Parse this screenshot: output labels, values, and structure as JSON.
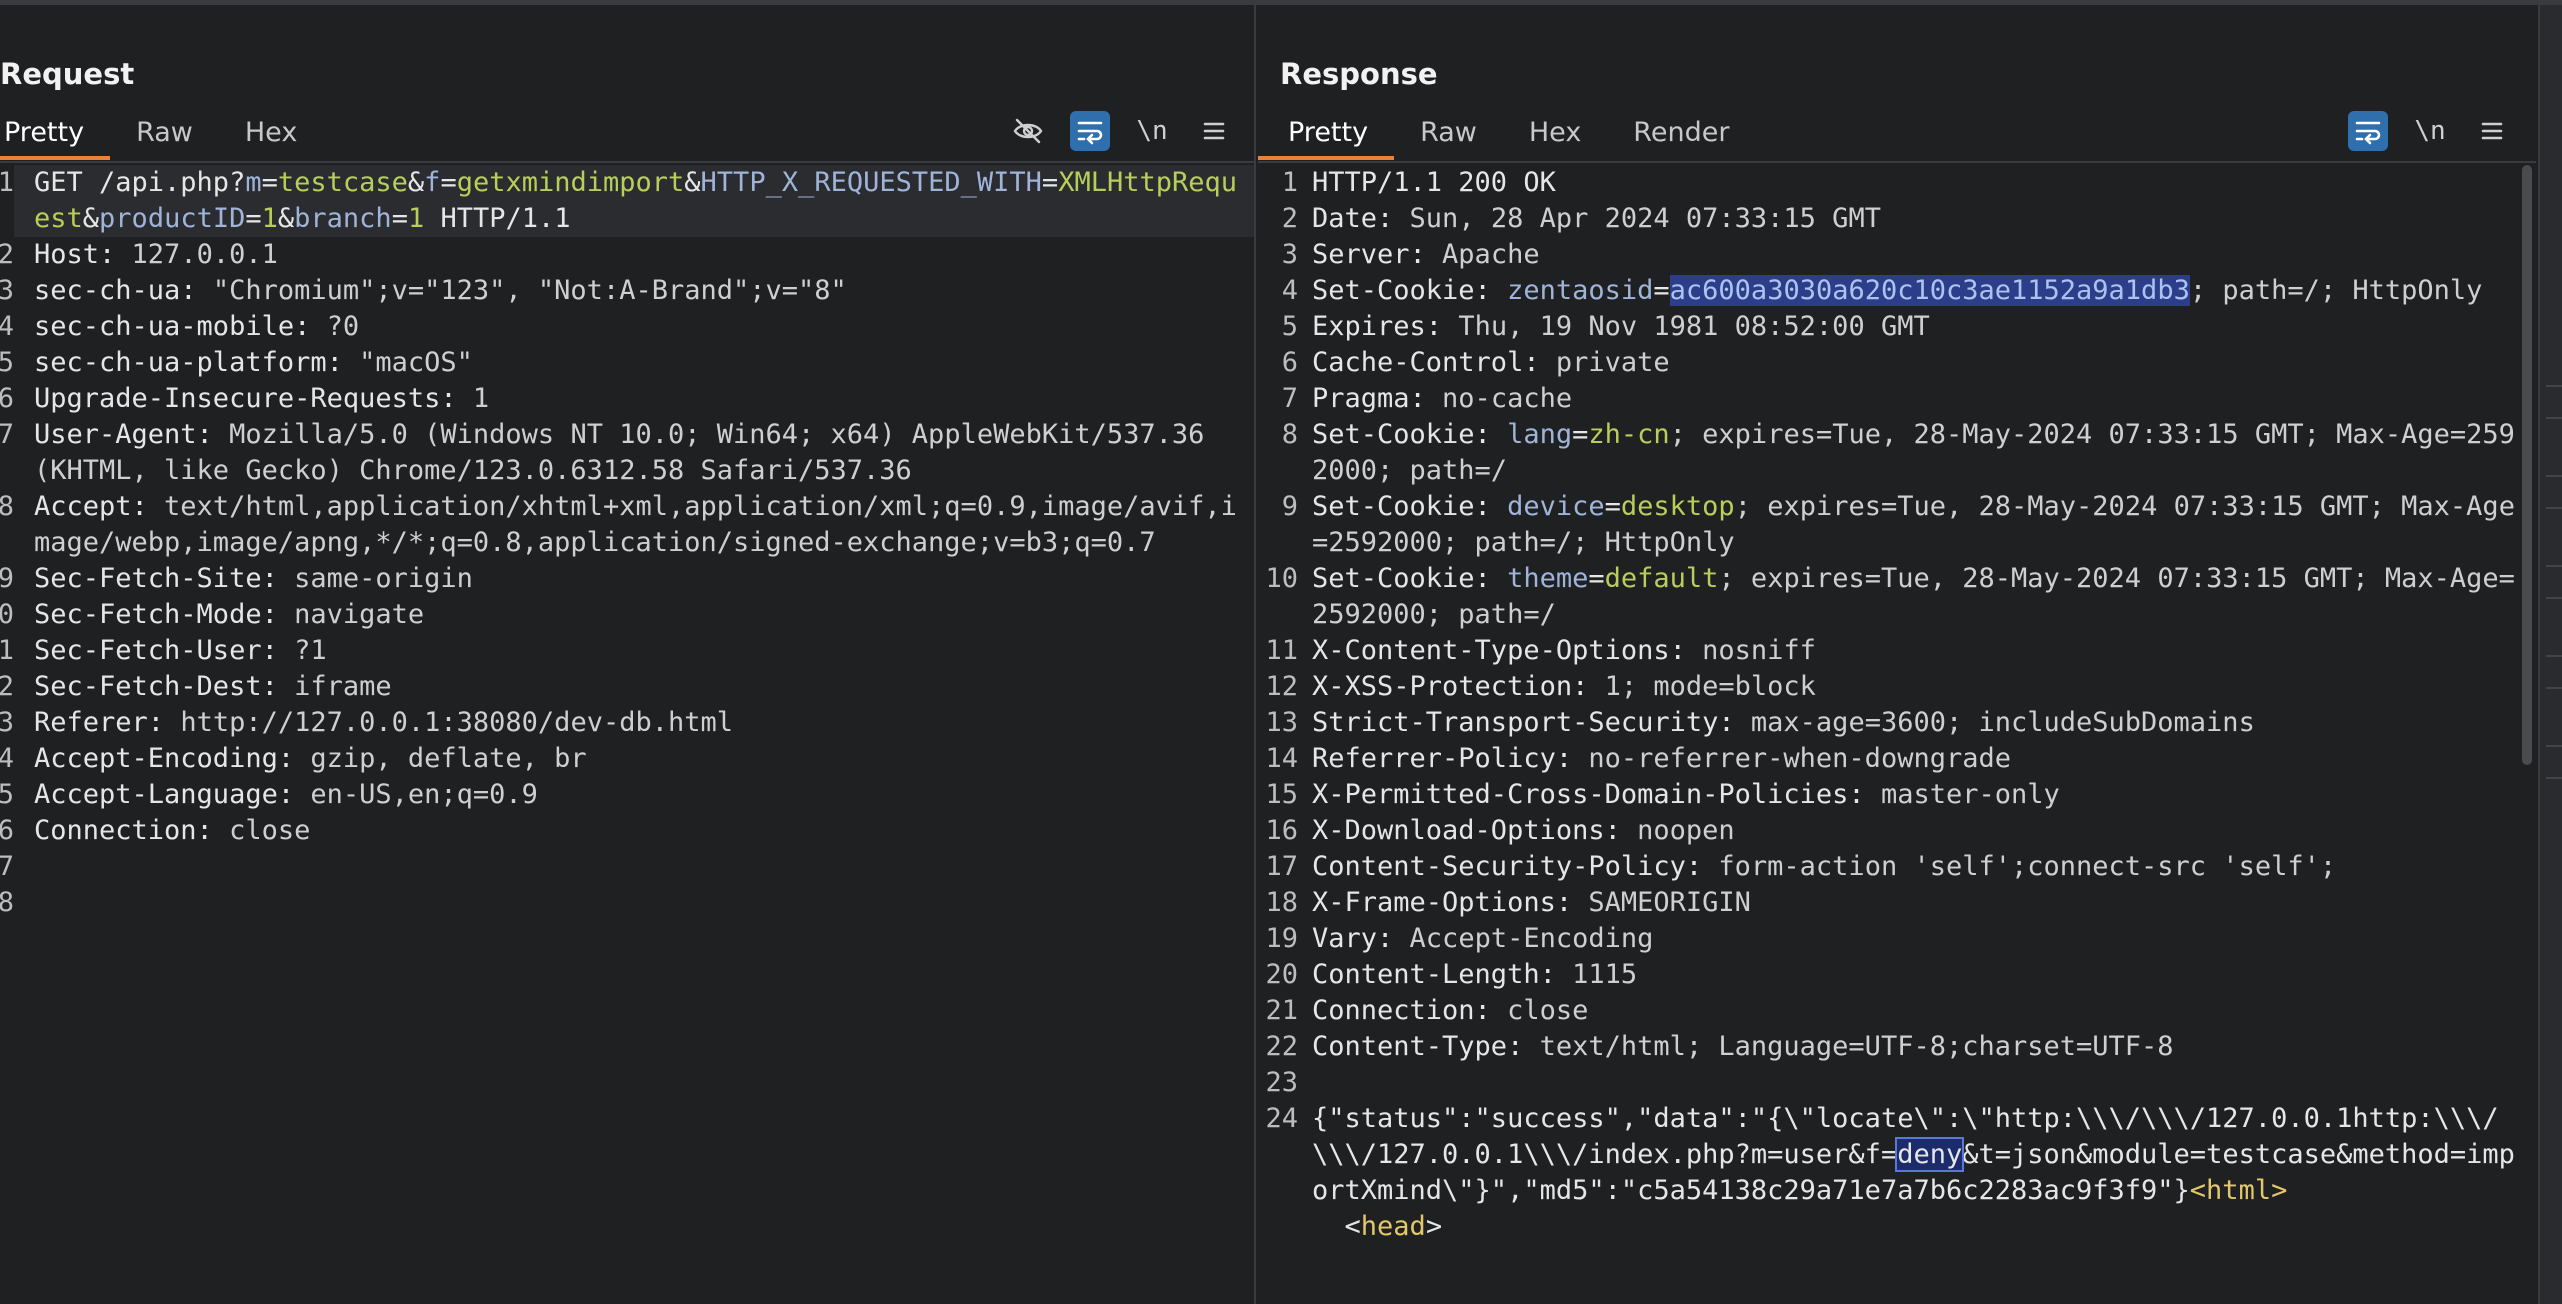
{
  "request": {
    "title": "Request",
    "tabs": [
      "Pretty",
      "Raw",
      "Hex"
    ],
    "tools": {
      "hide_icon": "eye-slash-icon",
      "wrap_icon": "wrap-lines-icon",
      "newline_label": "\\n",
      "menu_icon": "hamburger-menu-icon"
    },
    "lines": [
      {
        "num": "1",
        "parts": [
          [
            "GET /api.php?",
            "plain"
          ],
          [
            "m",
            "param"
          ],
          [
            "=",
            "plain"
          ],
          [
            "testcase",
            "pval"
          ],
          [
            "&",
            "plain"
          ],
          [
            "f",
            "param"
          ],
          [
            "=",
            "plain"
          ],
          [
            "getxmindimport",
            "pval"
          ],
          [
            "&",
            "plain"
          ],
          [
            "HTTP_X_REQUESTED_WITH",
            "param"
          ],
          [
            "=",
            "plain"
          ],
          [
            "XMLHttpRequest",
            "pval"
          ],
          [
            "&",
            "plain"
          ],
          [
            "productID",
            "param"
          ],
          [
            "=",
            "plain"
          ],
          [
            "1",
            "pval"
          ],
          [
            "&",
            "plain"
          ],
          [
            "branch",
            "param"
          ],
          [
            "=",
            "plain"
          ],
          [
            "1",
            "pval"
          ],
          [
            " HTTP/1.1",
            "plain"
          ]
        ]
      },
      {
        "num": "2",
        "parts": [
          [
            "Host: ",
            "hdr"
          ],
          [
            "127.0.0.1",
            "val"
          ]
        ]
      },
      {
        "num": "3",
        "parts": [
          [
            "sec-ch-ua: ",
            "hdr"
          ],
          [
            "\"Chromium\";v=\"123\", \"Not:A-Brand\";v=\"8\"",
            "val"
          ]
        ]
      },
      {
        "num": "4",
        "parts": [
          [
            "sec-ch-ua-mobile: ",
            "hdr"
          ],
          [
            "?0",
            "val"
          ]
        ]
      },
      {
        "num": "5",
        "parts": [
          [
            "sec-ch-ua-platform: ",
            "hdr"
          ],
          [
            "\"macOS\"",
            "val"
          ]
        ]
      },
      {
        "num": "6",
        "parts": [
          [
            "Upgrade-Insecure-Requests: ",
            "hdr"
          ],
          [
            "1",
            "val"
          ]
        ]
      },
      {
        "num": "7",
        "parts": [
          [
            "User-Agent: ",
            "hdr"
          ],
          [
            "Mozilla/5.0 (Windows NT 10.0; Win64; x64) AppleWebKit/537.36 (KHTML, like Gecko) Chrome/123.0.6312.58 Safari/537.36",
            "val"
          ]
        ]
      },
      {
        "num": "8",
        "parts": [
          [
            "Accept: ",
            "hdr"
          ],
          [
            "text/html,application/xhtml+xml,application/xml;q=0.9,image/avif,image/webp,image/apng,*/*;q=0.8,application/signed-exchange;v=b3;q=0.7",
            "val"
          ]
        ]
      },
      {
        "num": "9",
        "parts": [
          [
            "Sec-Fetch-Site: ",
            "hdr"
          ],
          [
            "same-origin",
            "val"
          ]
        ]
      },
      {
        "num": "0",
        "parts": [
          [
            "Sec-Fetch-Mode: ",
            "hdr"
          ],
          [
            "navigate",
            "val"
          ]
        ]
      },
      {
        "num": "1",
        "parts": [
          [
            "Sec-Fetch-User: ",
            "hdr"
          ],
          [
            "?1",
            "val"
          ]
        ]
      },
      {
        "num": "2",
        "parts": [
          [
            "Sec-Fetch-Dest: ",
            "hdr"
          ],
          [
            "iframe",
            "val"
          ]
        ]
      },
      {
        "num": "3",
        "parts": [
          [
            "Referer: ",
            "hdr"
          ],
          [
            "http://127.0.0.1:38080/dev-db.html",
            "val"
          ]
        ]
      },
      {
        "num": "4",
        "parts": [
          [
            "Accept-Encoding: ",
            "hdr"
          ],
          [
            "gzip, deflate, br",
            "val"
          ]
        ]
      },
      {
        "num": "5",
        "parts": [
          [
            "Accept-Language: ",
            "hdr"
          ],
          [
            "en-US,en;q=0.9",
            "val"
          ]
        ]
      },
      {
        "num": "6",
        "parts": [
          [
            "Connection: ",
            "hdr"
          ],
          [
            "close",
            "val"
          ]
        ]
      },
      {
        "num": "7",
        "parts": [
          [
            "",
            "plain"
          ]
        ]
      },
      {
        "num": "8",
        "parts": [
          [
            "",
            "plain"
          ]
        ]
      }
    ]
  },
  "response": {
    "title": "Response",
    "tabs": [
      "Pretty",
      "Raw",
      "Hex",
      "Render"
    ],
    "tools": {
      "wrap_icon": "wrap-lines-icon",
      "newline_label": "\\n",
      "menu_icon": "hamburger-menu-icon"
    },
    "lines": [
      {
        "num": "1",
        "parts": [
          [
            "HTTP/1.1 200 OK",
            "plain"
          ]
        ]
      },
      {
        "num": "2",
        "parts": [
          [
            "Date: ",
            "hdr"
          ],
          [
            "Sun, 28 Apr 2024 07:33:15 GMT",
            "val"
          ]
        ]
      },
      {
        "num": "3",
        "parts": [
          [
            "Server: ",
            "hdr"
          ],
          [
            "Apache",
            "val"
          ]
        ]
      },
      {
        "num": "4",
        "parts": [
          [
            "Set-Cookie: ",
            "hdr"
          ],
          [
            "zentaosid",
            "param"
          ],
          [
            "=",
            "plain"
          ],
          [
            "ac600a3030a620c10c3ae1152a9a1db3",
            "sel"
          ],
          [
            "; path=/; HttpOnly",
            "val"
          ]
        ]
      },
      {
        "num": "5",
        "parts": [
          [
            "Expires: ",
            "hdr"
          ],
          [
            "Thu, 19 Nov 1981 08:52:00 GMT",
            "val"
          ]
        ]
      },
      {
        "num": "6",
        "parts": [
          [
            "Cache-Control: ",
            "hdr"
          ],
          [
            "private",
            "val"
          ]
        ]
      },
      {
        "num": "7",
        "parts": [
          [
            "Pragma: ",
            "hdr"
          ],
          [
            "no-cache",
            "val"
          ]
        ]
      },
      {
        "num": "8",
        "parts": [
          [
            "Set-Cookie: ",
            "hdr"
          ],
          [
            "lang",
            "param"
          ],
          [
            "=",
            "plain"
          ],
          [
            "zh-cn",
            "pval"
          ],
          [
            "; expires=Tue, 28-May-2024 07:33:15 GMT; Max-Age=2592000; path=/",
            "val"
          ]
        ]
      },
      {
        "num": "9",
        "parts": [
          [
            "Set-Cookie: ",
            "hdr"
          ],
          [
            "device",
            "param"
          ],
          [
            "=",
            "plain"
          ],
          [
            "desktop",
            "pval"
          ],
          [
            "; expires=Tue, 28-May-2024 07:33:15 GMT; Max-Age=2592000; path=/; HttpOnly",
            "val"
          ]
        ]
      },
      {
        "num": "10",
        "parts": [
          [
            "Set-Cookie: ",
            "hdr"
          ],
          [
            "theme",
            "param"
          ],
          [
            "=",
            "plain"
          ],
          [
            "default",
            "pval"
          ],
          [
            "; expires=Tue, 28-May-2024 07:33:15 GMT; Max-Age=2592000; path=/",
            "val"
          ]
        ]
      },
      {
        "num": "11",
        "parts": [
          [
            "X-Content-Type-Options: ",
            "hdr"
          ],
          [
            "nosniff",
            "val"
          ]
        ]
      },
      {
        "num": "12",
        "parts": [
          [
            "X-XSS-Protection: ",
            "hdr"
          ],
          [
            "1; mode=block",
            "val"
          ]
        ]
      },
      {
        "num": "13",
        "parts": [
          [
            "Strict-Transport-Security: ",
            "hdr"
          ],
          [
            "max-age=3600; includeSubDomains",
            "val"
          ]
        ]
      },
      {
        "num": "14",
        "parts": [
          [
            "Referrer-Policy: ",
            "hdr"
          ],
          [
            "no-referrer-when-downgrade",
            "val"
          ]
        ]
      },
      {
        "num": "15",
        "parts": [
          [
            "X-Permitted-Cross-Domain-Policies: ",
            "hdr"
          ],
          [
            "master-only",
            "val"
          ]
        ]
      },
      {
        "num": "16",
        "parts": [
          [
            "X-Download-Options: ",
            "hdr"
          ],
          [
            "noopen",
            "val"
          ]
        ]
      },
      {
        "num": "17",
        "parts": [
          [
            "Content-Security-Policy: ",
            "hdr"
          ],
          [
            "form-action 'self';connect-src 'self';",
            "val"
          ]
        ]
      },
      {
        "num": "18",
        "parts": [
          [
            "X-Frame-Options: ",
            "hdr"
          ],
          [
            "SAMEORIGIN",
            "val"
          ]
        ]
      },
      {
        "num": "19",
        "parts": [
          [
            "Vary: ",
            "hdr"
          ],
          [
            "Accept-Encoding",
            "val"
          ]
        ]
      },
      {
        "num": "20",
        "parts": [
          [
            "Content-Length: ",
            "hdr"
          ],
          [
            "1115",
            "val"
          ]
        ]
      },
      {
        "num": "21",
        "parts": [
          [
            "Connection: ",
            "hdr"
          ],
          [
            "close",
            "val"
          ]
        ]
      },
      {
        "num": "22",
        "parts": [
          [
            "Content-Type: ",
            "hdr"
          ],
          [
            "text/html; Language=UTF-8;charset=UTF-8",
            "val"
          ]
        ]
      },
      {
        "num": "23",
        "parts": [
          [
            "",
            "plain"
          ]
        ]
      },
      {
        "num": "24",
        "parts": [
          [
            "{\"status\":\"success\",\"data\":\"{\\\"locate\\\":\\\"http:\\\\\\/\\\\\\/127.0.0.1http:\\\\\\/\\\\\\/127.0.0.1\\\\\\/index.php?m=user&f=",
            "plain"
          ],
          [
            "deny",
            "box"
          ],
          [
            "&t=json&module=testcase&method=importXmind\\\"}\",\"md5\":\"c5a54138c29a71e7a7b6c2283ac9f3f9\"}",
            "plain"
          ],
          [
            "<html>",
            "tag"
          ]
        ]
      },
      {
        "num": "",
        "parts": [
          [
            "  <",
            "plain"
          ],
          [
            "head",
            "tag"
          ],
          [
            ">",
            "plain"
          ]
        ]
      }
    ]
  },
  "layout_buttons": [
    "split-columns-icon",
    "split-rows-icon",
    "single-pane-icon"
  ]
}
